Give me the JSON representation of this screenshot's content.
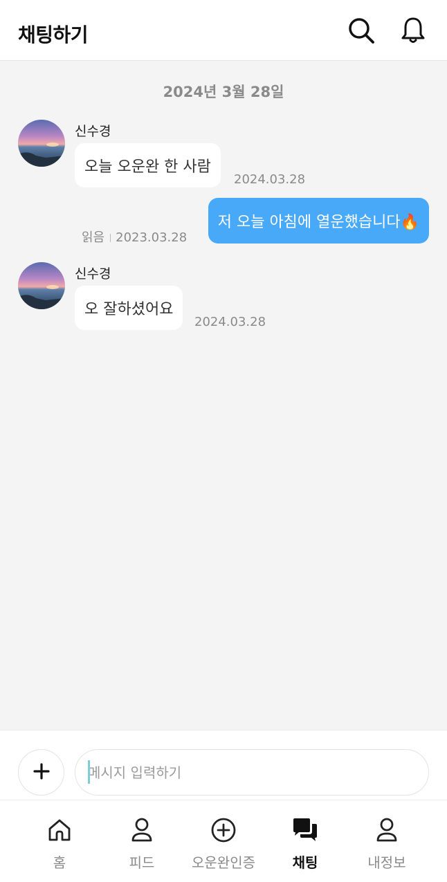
{
  "header": {
    "title": "채팅하기",
    "search_icon": "search-icon",
    "bell_icon": "bell-icon"
  },
  "chat": {
    "date_divider": "2024년 3월 28일",
    "messages": [
      {
        "direction": "incoming",
        "sender": "신수경",
        "text": "오늘 오운완 한 사람",
        "time": "2024.03.28"
      },
      {
        "direction": "outgoing",
        "text": "저 오늘 아침에 열운했습니다🔥",
        "read_label": "읽음",
        "time": "2023.03.28"
      },
      {
        "direction": "incoming",
        "sender": "신수경",
        "text": "오 잘하셨어요",
        "time": "2024.03.28"
      }
    ]
  },
  "composer": {
    "plus_icon": "plus-icon",
    "placeholder": "메시지 입력하기"
  },
  "tabs": [
    {
      "label": "홈",
      "icon": "home-icon",
      "active": false
    },
    {
      "label": "피드",
      "icon": "person-icon",
      "active": false
    },
    {
      "label": "오운완인증",
      "icon": "plus-circle-icon",
      "active": false
    },
    {
      "label": "채팅",
      "icon": "chat-bubbles-icon",
      "active": true
    },
    {
      "label": "내정보",
      "icon": "person-icon",
      "active": false
    }
  ],
  "colors": {
    "accent_blue": "#47a9f8",
    "background": "#f4f4f4",
    "muted_text": "#8a8a8a"
  }
}
